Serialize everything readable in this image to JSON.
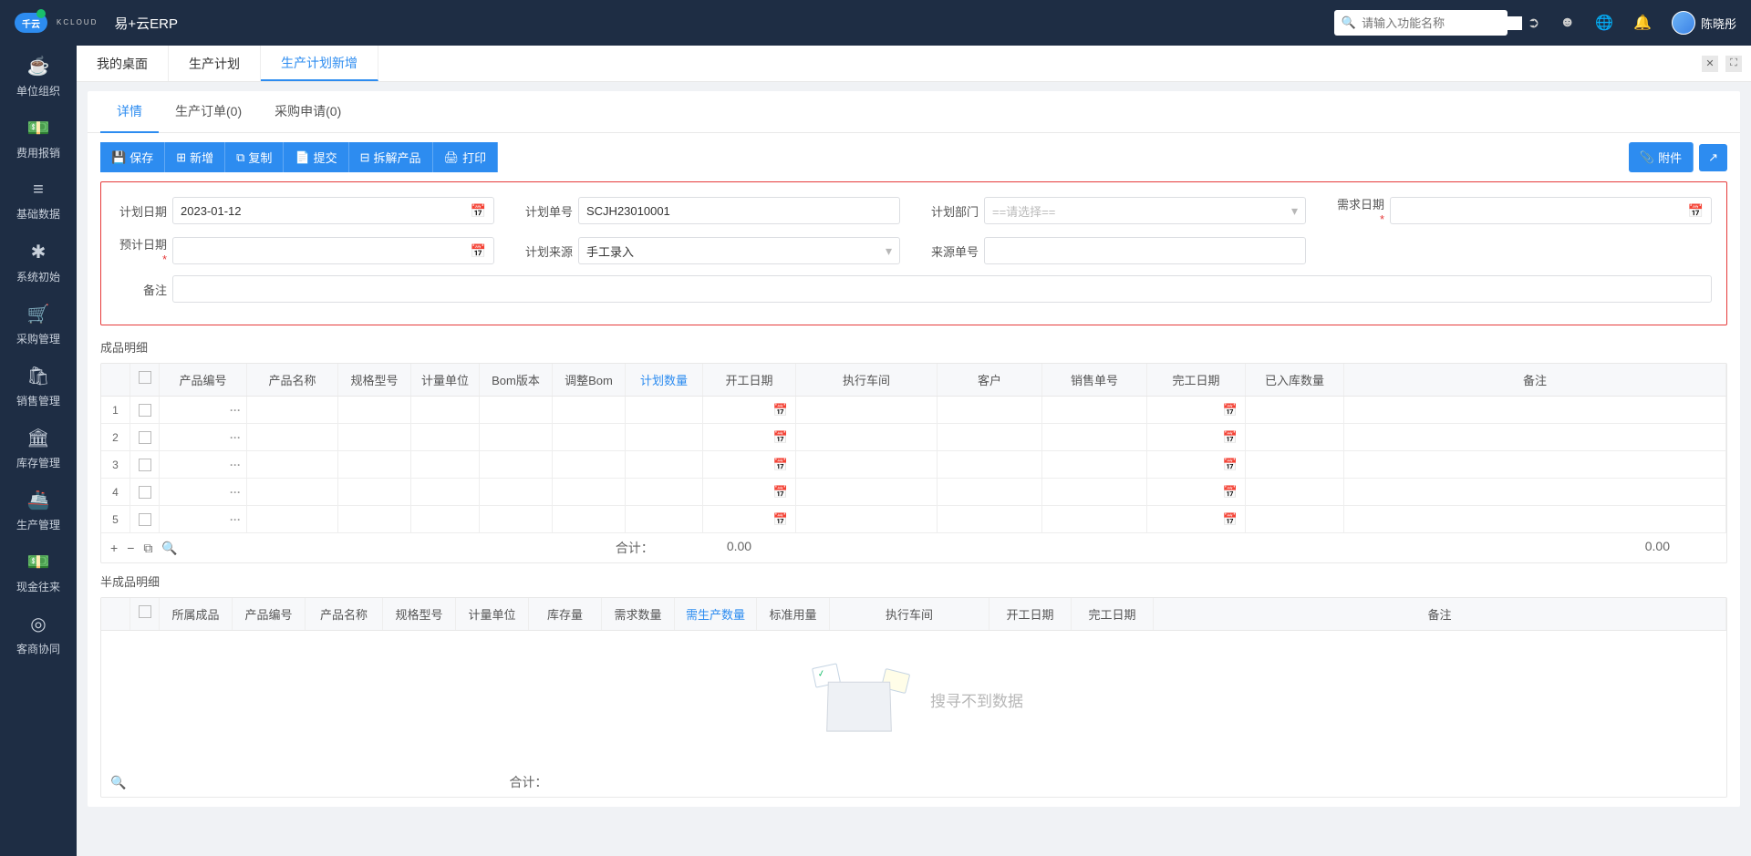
{
  "header": {
    "logo_main": "千云",
    "logo_sub": "KCLOUD",
    "app": "易+云ERP",
    "search_placeholder": "请输入功能名称",
    "user": "陈晓彤"
  },
  "sidebar": [
    {
      "icon": "☕",
      "label": "单位组织"
    },
    {
      "icon": "💵",
      "label": "费用报销"
    },
    {
      "icon": "≡",
      "label": "基础数据"
    },
    {
      "icon": "✱",
      "label": "系统初始"
    },
    {
      "icon": "🛒",
      "label": "采购管理"
    },
    {
      "icon": "🛍",
      "label": "销售管理"
    },
    {
      "icon": "🏛",
      "label": "库存管理"
    },
    {
      "icon": "🚢",
      "label": "生产管理"
    },
    {
      "icon": "💵",
      "label": "现金往来"
    },
    {
      "icon": "◎",
      "label": "客商协同"
    }
  ],
  "win_tabs": [
    "我的桌面",
    "生产计划",
    "生产计划新增"
  ],
  "win_active": 2,
  "sub_tabs": [
    "详情",
    "生产订单(0)",
    "采购申请(0)"
  ],
  "sub_active": 0,
  "toolbar": {
    "save": "保存",
    "new": "新增",
    "copy": "复制",
    "submit": "提交",
    "break": "拆解产品",
    "print": "打印",
    "attach": "附件"
  },
  "form": {
    "plan_date_lbl": "计划日期",
    "plan_date": "2023-01-12",
    "plan_no_lbl": "计划单号",
    "plan_no": "SCJH23010001",
    "dept_lbl": "计划部门",
    "dept_placeholder": "==请选择==",
    "demand_date_lbl": "需求日期",
    "expect_date_lbl": "预计日期",
    "source_lbl": "计划来源",
    "source": "手工录入",
    "src_no_lbl": "来源单号",
    "remark_lbl": "备注"
  },
  "sec1": "成品明细",
  "grid1": {
    "cols": [
      "产品编号",
      "产品名称",
      "规格型号",
      "计量单位",
      "Bom版本",
      "调整Bom",
      "计划数量",
      "开工日期",
      "执行车间",
      "客户",
      "销售单号",
      "完工日期",
      "已入库数量",
      "备注"
    ],
    "hl_col": 6,
    "rows": 5,
    "sum_lbl": "合计：",
    "sum_v1": "0.00",
    "sum_v2": "0.00"
  },
  "sec2": "半成品明细",
  "grid2": {
    "cols": [
      "所属成品",
      "产品编号",
      "产品名称",
      "规格型号",
      "计量单位",
      "库存量",
      "需求数量",
      "需生产数量",
      "标准用量",
      "执行车间",
      "开工日期",
      "完工日期",
      "备注"
    ],
    "hl_col": 7,
    "empty": "搜寻不到数据",
    "sum_lbl": "合计："
  }
}
